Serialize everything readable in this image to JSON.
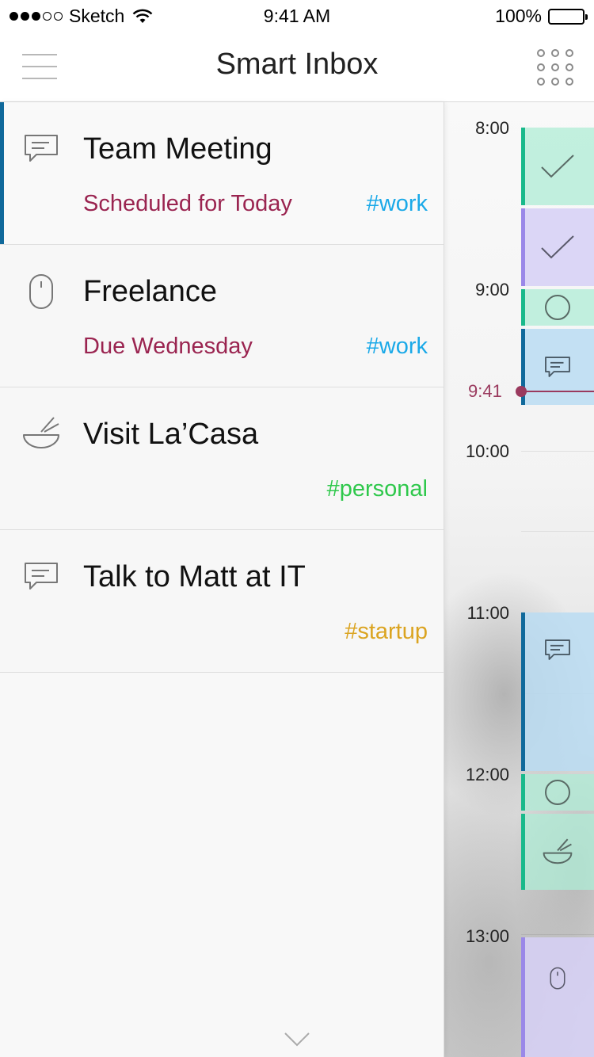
{
  "status_bar": {
    "carrier": "Sketch",
    "time": "9:41 AM",
    "battery": "100%"
  },
  "nav": {
    "title": "Smart Inbox",
    "menu_icon": "hamburger-menu-icon",
    "apps_icon": "grid-icon"
  },
  "tasks": [
    {
      "title": "Team Meeting",
      "due": "Scheduled for Today",
      "tag": "#work",
      "icon": "chat-icon",
      "selected": true
    },
    {
      "title": "Freelance",
      "due": "Due Wednesday",
      "tag": "#work",
      "icon": "mouse-icon"
    },
    {
      "title": "Visit La’Casa",
      "due": "",
      "tag": "#personal",
      "icon": "bowl-icon"
    },
    {
      "title": "Talk to Matt at IT",
      "due": "",
      "tag": "#startup",
      "icon": "chat-icon"
    }
  ],
  "calendar": {
    "hours": [
      "8:00",
      "9:00",
      "10:00",
      "11:00",
      "12:00",
      "13:00"
    ],
    "current_time": "9:41"
  },
  "colors": {
    "accent_blue": "#10699b",
    "due_red": "#9a2450",
    "tag_work": "#1aa9e8",
    "tag_personal": "#2ec84b",
    "tag_startup": "#dba421",
    "event_green": "#19b98b",
    "event_purple": "#9a88e8",
    "now_line": "#9a3a5e"
  }
}
